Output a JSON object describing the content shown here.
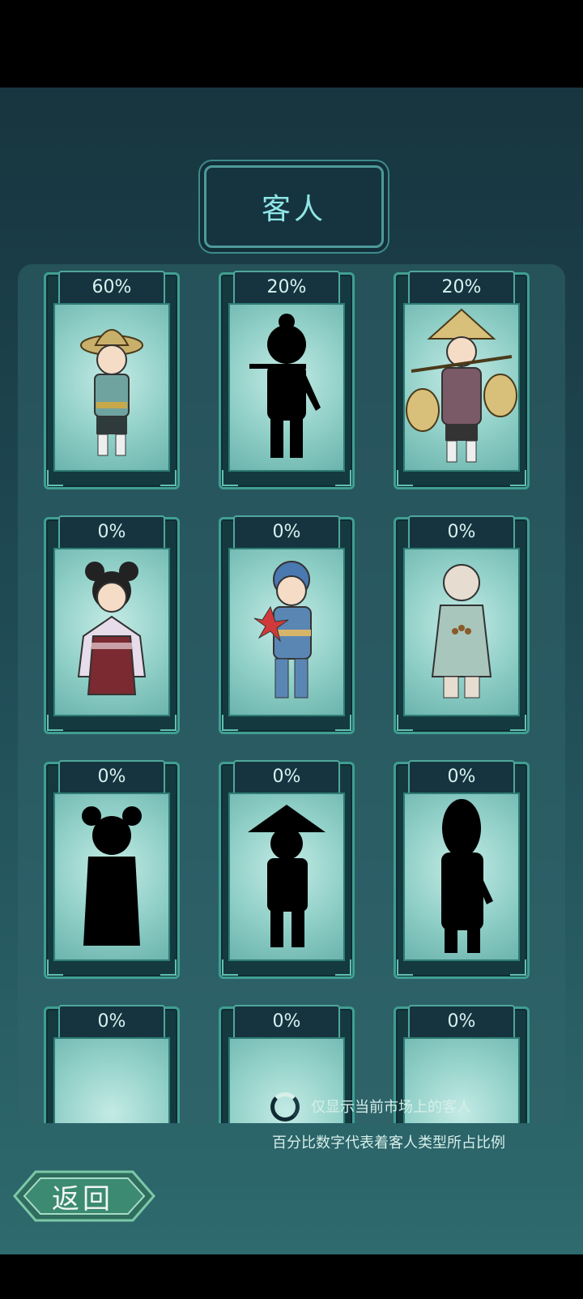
{
  "title": "客人",
  "cards": [
    {
      "percent": "60%",
      "unlocked": true,
      "character": "farmer-straw-hat"
    },
    {
      "percent": "20%",
      "unlocked": false,
      "character": "silhouette-carrying-pole"
    },
    {
      "percent": "20%",
      "unlocked": true,
      "character": "old-porter-with-baskets"
    },
    {
      "percent": "0%",
      "unlocked": true,
      "character": "girl-red-dress"
    },
    {
      "percent": "0%",
      "unlocked": true,
      "character": "boy-pinwheel"
    },
    {
      "percent": "0%",
      "unlocked": true,
      "character": "young-monk"
    },
    {
      "percent": "0%",
      "unlocked": false,
      "character": "silhouette-girl-buns"
    },
    {
      "percent": "0%",
      "unlocked": false,
      "character": "silhouette-conical-hat"
    },
    {
      "percent": "0%",
      "unlocked": false,
      "character": "silhouette-robed-figure"
    },
    {
      "percent": "0%",
      "unlocked": false,
      "character": "partial-row"
    },
    {
      "percent": "0%",
      "unlocked": false,
      "character": "partial-row"
    },
    {
      "percent": "0%",
      "unlocked": false,
      "character": "partial-row"
    }
  ],
  "hints": {
    "toggle_label": "仅显示当前市场上的客人",
    "note": "百分比数字代表着客人类型所占比例"
  },
  "back_label": "返回",
  "colors": {
    "accent": "#4fa79a",
    "title_text": "#8fe6e6",
    "panel": "#2e5f66"
  }
}
